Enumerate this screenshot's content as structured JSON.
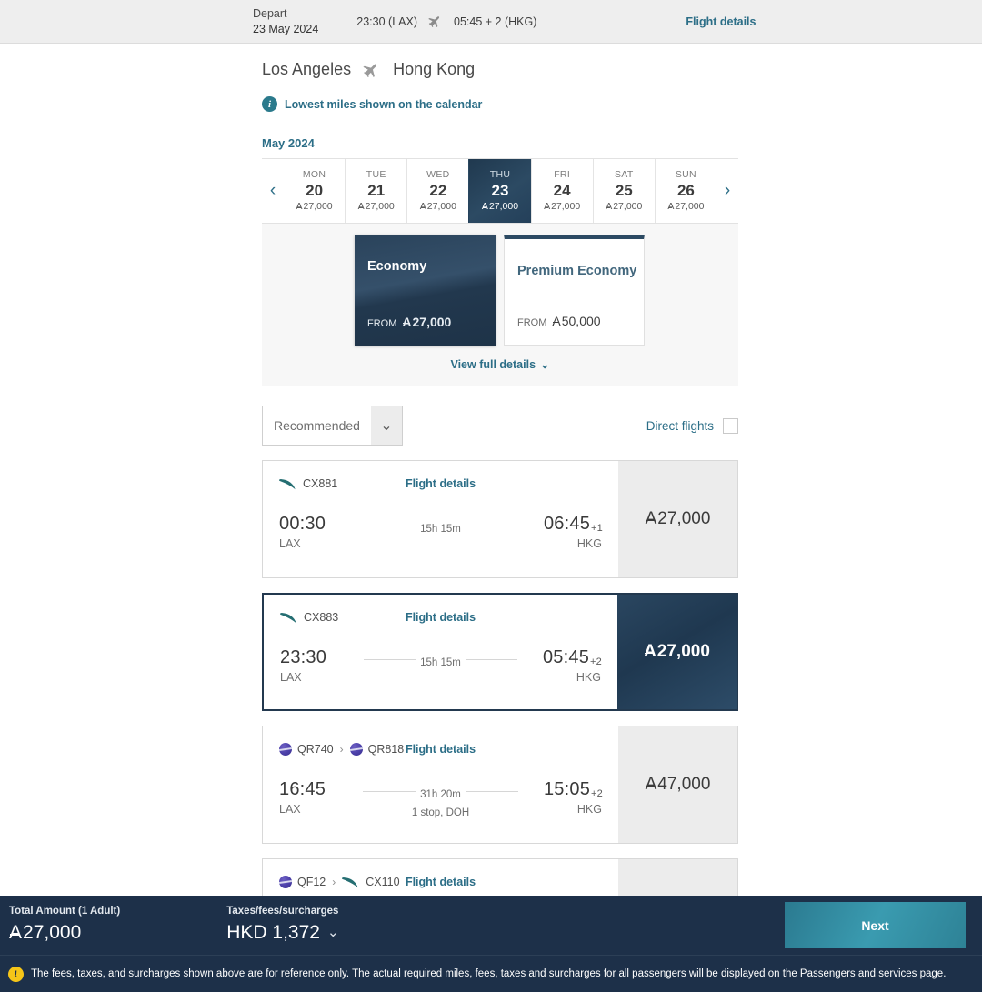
{
  "topbar": {
    "depart_label": "Depart",
    "depart_date": "23 May 2024",
    "origin_time": "23:30 (LAX)",
    "dest_time": "05:45 + 2 (HKG)",
    "flight_details_link": "Flight details"
  },
  "route": {
    "origin_city": "Los Angeles",
    "destination_city": "Hong Kong"
  },
  "note": {
    "text": "Lowest miles shown on the calendar"
  },
  "calendar": {
    "month": "May 2024",
    "prev_label": "‹",
    "next_label": "›",
    "days": [
      {
        "dow": "MON",
        "num": "20",
        "miles": "27,000",
        "selected": false
      },
      {
        "dow": "TUE",
        "num": "21",
        "miles": "27,000",
        "selected": false
      },
      {
        "dow": "WED",
        "num": "22",
        "miles": "27,000",
        "selected": false
      },
      {
        "dow": "THU",
        "num": "23",
        "miles": "27,000",
        "selected": true
      },
      {
        "dow": "FRI",
        "num": "24",
        "miles": "27,000",
        "selected": false
      },
      {
        "dow": "SAT",
        "num": "25",
        "miles": "27,000",
        "selected": false
      },
      {
        "dow": "SUN",
        "num": "26",
        "miles": "27,000",
        "selected": false
      }
    ]
  },
  "cabins": {
    "economy": {
      "title": "Economy",
      "from_label": "FROM",
      "miles": "27,000",
      "selected": true
    },
    "premium": {
      "title": "Premium Economy",
      "from_label": "FROM",
      "miles": "50,000",
      "selected": false
    },
    "view_full_details": "View full details"
  },
  "filters": {
    "sort_value": "Recommended",
    "direct_label": "Direct flights",
    "direct_checked": false
  },
  "flights": [
    {
      "carriers": [
        {
          "code": "CX881",
          "logo": "cathay-brushwing-icon"
        }
      ],
      "details_link": "Flight details",
      "depart_time": "00:30",
      "depart_airport": "LAX",
      "duration": "15h 15m",
      "stops": "",
      "arrive_time": "06:45",
      "arrive_offset": "+1",
      "arrive_airport": "HKG",
      "price": "27,000",
      "selected": false
    },
    {
      "carriers": [
        {
          "code": "CX883",
          "logo": "cathay-brushwing-icon"
        }
      ],
      "details_link": "Flight details",
      "depart_time": "23:30",
      "depart_airport": "LAX",
      "duration": "15h 15m",
      "stops": "",
      "arrive_time": "05:45",
      "arrive_offset": "+2",
      "arrive_airport": "HKG",
      "price": "27,000",
      "selected": true
    },
    {
      "carriers": [
        {
          "code": "QR740",
          "logo": "qatar-circle-icon"
        },
        {
          "code": "QR818",
          "logo": "qatar-circle-icon"
        }
      ],
      "details_link": "Flight details",
      "depart_time": "16:45",
      "depart_airport": "LAX",
      "duration": "31h 20m",
      "stops": "1 stop, DOH",
      "arrive_time": "15:05",
      "arrive_offset": "+2",
      "arrive_airport": "HKG",
      "price": "47,000",
      "selected": false
    },
    {
      "carriers": [
        {
          "code": "QF12",
          "logo": "qantas-circle-icon"
        },
        {
          "code": "CX110",
          "logo": "cathay-brushwing-icon"
        }
      ],
      "details_link": "Flight details",
      "depart_time": "",
      "depart_airport": "",
      "duration": "",
      "stops": "",
      "arrive_time": "",
      "arrive_offset": "",
      "arrive_airport": "",
      "price": "",
      "selected": false
    }
  ],
  "footer": {
    "total_label": "Total Amount (1 Adult)",
    "total_miles": "27,000",
    "taxes_label": "Taxes/fees/surcharges",
    "taxes_value": "HKD 1,372",
    "taxes_chevron": "⌄",
    "next_label": "Next"
  },
  "warning": {
    "text": "The fees, taxes, and surcharges shown above are for reference only. The actual required miles, fees, taxes and surcharges for all passengers will be displayed on the Passengers and services page."
  },
  "colors": {
    "accent_teal": "#2c6e87",
    "navy": "#1d3049",
    "selected_navy": "#23394f",
    "next_button": "#2e8296",
    "warning_yellow": "#f5c518",
    "panel_grey": "#f7f7f7"
  }
}
